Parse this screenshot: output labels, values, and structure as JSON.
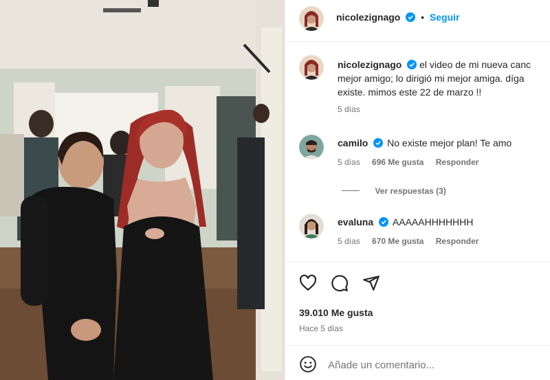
{
  "header": {
    "username": "nicolezignago",
    "separator": "•",
    "follow_label": "Seguir"
  },
  "caption": {
    "username": "nicolezignago",
    "line1": "el video de mi nueva canc",
    "line2": "mejor amigo; lo dirigió mi mejor amiga. díga",
    "line3": "existe. mimos este 22 de marzo !!",
    "time": "5 días"
  },
  "comments": [
    {
      "username": "camilo",
      "text": "No existe mejor plan! Te amo",
      "time": "5 días",
      "likes": "696 Me gusta",
      "reply": "Responder"
    },
    {
      "username": "evaluna",
      "text": "AAAAAHHHHHHH",
      "time": "5 días",
      "likes": "670 Me gusta",
      "reply": "Responder"
    }
  ],
  "view_replies": "Ver respuestas (3)",
  "actions": {
    "likes": "39.010 Me gusta",
    "timestamp": "Hace 5 días"
  },
  "comment_box": {
    "placeholder": "Añade un comentario..."
  },
  "icons": [
    "heart-icon",
    "comment-icon",
    "share-icon",
    "emoji-icon",
    "verified-icon"
  ],
  "colors": {
    "accent": "#0095f6",
    "verified": "#0095f6",
    "text": "#262626",
    "secondary": "#737373"
  }
}
